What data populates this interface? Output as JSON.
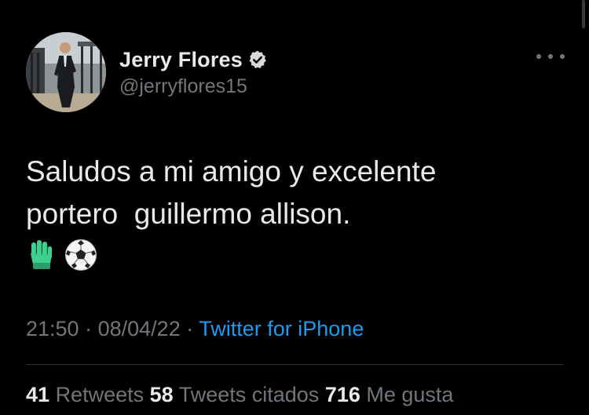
{
  "author": {
    "display_name": "Jerry Flores",
    "handle": "@jerryflores15",
    "verified": true,
    "avatar_icon": "profile-photo"
  },
  "tweet": {
    "text": "Saludos a mi amigo y excelente\nportero  guillermo allison.",
    "emojis": [
      "goalkeeper-glove-icon",
      "soccer-ball-icon"
    ]
  },
  "meta": {
    "time": "21:50",
    "date": "08/04/22",
    "separator": "·",
    "source": "Twitter for iPhone"
  },
  "stats": {
    "retweets_count": "41",
    "retweets_label": "Retweets",
    "quotes_count": "58",
    "quotes_label": "Tweets citados",
    "likes_count": "716",
    "likes_label": "Me gusta"
  },
  "colors": {
    "background": "#000000",
    "text": "#e7e9ea",
    "secondary": "#71767b",
    "accent": "#1d9bf0"
  }
}
